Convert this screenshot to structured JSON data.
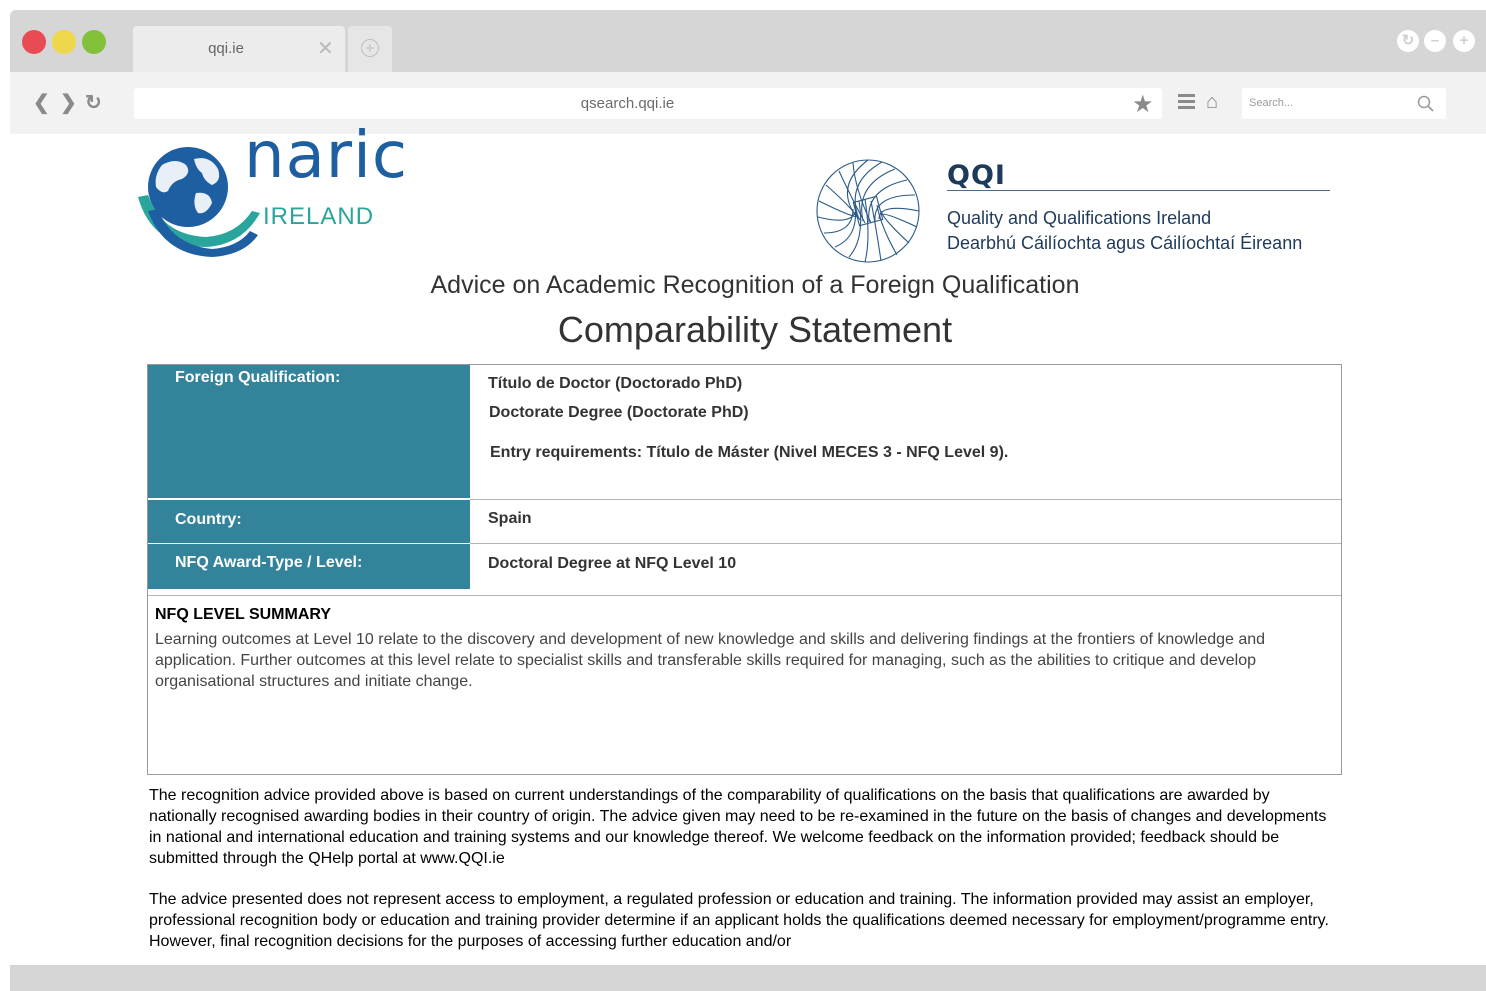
{
  "browser": {
    "tab_title": "qqi.ie",
    "tab_close": "✕",
    "new_tab": "+",
    "url": "qsearch.qqi.ie",
    "search_placeholder": "Search...",
    "traffic_lights": [
      "#e94b54",
      "#efd74b",
      "#84c13a"
    ],
    "nav": {
      "back": "❮",
      "forward": "❯",
      "reload": "↻"
    }
  },
  "logos": {
    "naric": {
      "word": "naric",
      "sub": "IRELAND"
    },
    "qqi": {
      "name": "QQI",
      "english": "Quality and Qualifications Ireland",
      "irish": "Dearbhú Cáilíochta agus Cáilíochtaí Éireann"
    }
  },
  "page": {
    "heading": "Advice on Academic Recognition of a Foreign Qualification",
    "title": "Comparability Statement"
  },
  "statement": {
    "foreign_qualification_label": "Foreign Qualification:",
    "foreign_qualification_lines": [
      "Título de Doctor (Doctorado PhD)",
      "Doctorate Degree (Doctorate PhD)",
      "Entry requirements: Título de Máster (Nivel MECES 3 - NFQ Level 9)."
    ],
    "country_label": "Country:",
    "country_value": "Spain",
    "nfq_label": "NFQ Award-Type /  Level:",
    "nfq_value": "Doctoral Degree at NFQ Level 10",
    "summary_title": "NFQ LEVEL SUMMARY",
    "summary_text": "Learning outcomes at Level 10 relate to the discovery and development of new knowledge and skills and delivering findings at the frontiers of knowledge and application. Further outcomes at this level relate to specialist skills and transferable skills required for managing, such as the abilities to critique and develop organisational structures and initiate change."
  },
  "disclaimer": [
    "The recognition advice provided above is based on current understandings of the comparability of qualifications on the basis that qualifications are awarded by nationally recognised awarding bodies in their country of origin. The advice given may need to be re-examined in the future on the basis of changes and developments in national and international education and training systems and our knowledge thereof. We welcome feedback on the information provided; feedback should be submitted through the QHelp portal at www.QQI.ie",
    "The advice presented does not represent access to employment, a regulated profession or education and training. The information provided may assist an employer, professional recognition body or education and training provider determine if an applicant holds the qualifications deemed necessary for employment/programme entry. However, final recognition decisions for the purposes of accessing further education and/or"
  ],
  "colors": {
    "label_bg": "#33839b",
    "naric_blue": "#1e5fa2",
    "naric_teal": "#2aa59c",
    "qqi_navy": "#1e3a5a"
  }
}
